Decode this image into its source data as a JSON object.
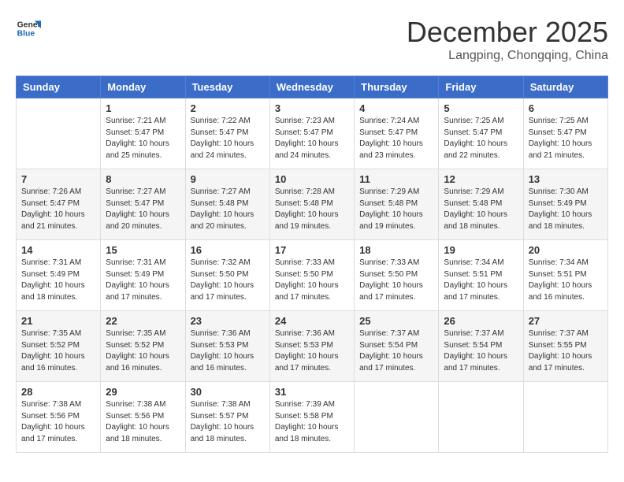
{
  "header": {
    "logo_line1": "General",
    "logo_line2": "Blue",
    "month": "December 2025",
    "location": "Langping, Chongqing, China"
  },
  "days_of_week": [
    "Sunday",
    "Monday",
    "Tuesday",
    "Wednesday",
    "Thursday",
    "Friday",
    "Saturday"
  ],
  "weeks": [
    [
      {
        "day": "",
        "content": ""
      },
      {
        "day": "1",
        "content": "Sunrise: 7:21 AM\nSunset: 5:47 PM\nDaylight: 10 hours\nand 25 minutes."
      },
      {
        "day": "2",
        "content": "Sunrise: 7:22 AM\nSunset: 5:47 PM\nDaylight: 10 hours\nand 24 minutes."
      },
      {
        "day": "3",
        "content": "Sunrise: 7:23 AM\nSunset: 5:47 PM\nDaylight: 10 hours\nand 24 minutes."
      },
      {
        "day": "4",
        "content": "Sunrise: 7:24 AM\nSunset: 5:47 PM\nDaylight: 10 hours\nand 23 minutes."
      },
      {
        "day": "5",
        "content": "Sunrise: 7:25 AM\nSunset: 5:47 PM\nDaylight: 10 hours\nand 22 minutes."
      },
      {
        "day": "6",
        "content": "Sunrise: 7:25 AM\nSunset: 5:47 PM\nDaylight: 10 hours\nand 21 minutes."
      }
    ],
    [
      {
        "day": "7",
        "content": "Sunrise: 7:26 AM\nSunset: 5:47 PM\nDaylight: 10 hours\nand 21 minutes."
      },
      {
        "day": "8",
        "content": "Sunrise: 7:27 AM\nSunset: 5:47 PM\nDaylight: 10 hours\nand 20 minutes."
      },
      {
        "day": "9",
        "content": "Sunrise: 7:27 AM\nSunset: 5:48 PM\nDaylight: 10 hours\nand 20 minutes."
      },
      {
        "day": "10",
        "content": "Sunrise: 7:28 AM\nSunset: 5:48 PM\nDaylight: 10 hours\nand 19 minutes."
      },
      {
        "day": "11",
        "content": "Sunrise: 7:29 AM\nSunset: 5:48 PM\nDaylight: 10 hours\nand 19 minutes."
      },
      {
        "day": "12",
        "content": "Sunrise: 7:29 AM\nSunset: 5:48 PM\nDaylight: 10 hours\nand 18 minutes."
      },
      {
        "day": "13",
        "content": "Sunrise: 7:30 AM\nSunset: 5:49 PM\nDaylight: 10 hours\nand 18 minutes."
      }
    ],
    [
      {
        "day": "14",
        "content": "Sunrise: 7:31 AM\nSunset: 5:49 PM\nDaylight: 10 hours\nand 18 minutes."
      },
      {
        "day": "15",
        "content": "Sunrise: 7:31 AM\nSunset: 5:49 PM\nDaylight: 10 hours\nand 17 minutes."
      },
      {
        "day": "16",
        "content": "Sunrise: 7:32 AM\nSunset: 5:50 PM\nDaylight: 10 hours\nand 17 minutes."
      },
      {
        "day": "17",
        "content": "Sunrise: 7:33 AM\nSunset: 5:50 PM\nDaylight: 10 hours\nand 17 minutes."
      },
      {
        "day": "18",
        "content": "Sunrise: 7:33 AM\nSunset: 5:50 PM\nDaylight: 10 hours\nand 17 minutes."
      },
      {
        "day": "19",
        "content": "Sunrise: 7:34 AM\nSunset: 5:51 PM\nDaylight: 10 hours\nand 17 minutes."
      },
      {
        "day": "20",
        "content": "Sunrise: 7:34 AM\nSunset: 5:51 PM\nDaylight: 10 hours\nand 16 minutes."
      }
    ],
    [
      {
        "day": "21",
        "content": "Sunrise: 7:35 AM\nSunset: 5:52 PM\nDaylight: 10 hours\nand 16 minutes."
      },
      {
        "day": "22",
        "content": "Sunrise: 7:35 AM\nSunset: 5:52 PM\nDaylight: 10 hours\nand 16 minutes."
      },
      {
        "day": "23",
        "content": "Sunrise: 7:36 AM\nSunset: 5:53 PM\nDaylight: 10 hours\nand 16 minutes."
      },
      {
        "day": "24",
        "content": "Sunrise: 7:36 AM\nSunset: 5:53 PM\nDaylight: 10 hours\nand 17 minutes."
      },
      {
        "day": "25",
        "content": "Sunrise: 7:37 AM\nSunset: 5:54 PM\nDaylight: 10 hours\nand 17 minutes."
      },
      {
        "day": "26",
        "content": "Sunrise: 7:37 AM\nSunset: 5:54 PM\nDaylight: 10 hours\nand 17 minutes."
      },
      {
        "day": "27",
        "content": "Sunrise: 7:37 AM\nSunset: 5:55 PM\nDaylight: 10 hours\nand 17 minutes."
      }
    ],
    [
      {
        "day": "28",
        "content": "Sunrise: 7:38 AM\nSunset: 5:56 PM\nDaylight: 10 hours\nand 17 minutes."
      },
      {
        "day": "29",
        "content": "Sunrise: 7:38 AM\nSunset: 5:56 PM\nDaylight: 10 hours\nand 18 minutes."
      },
      {
        "day": "30",
        "content": "Sunrise: 7:38 AM\nSunset: 5:57 PM\nDaylight: 10 hours\nand 18 minutes."
      },
      {
        "day": "31",
        "content": "Sunrise: 7:39 AM\nSunset: 5:58 PM\nDaylight: 10 hours\nand 18 minutes."
      },
      {
        "day": "",
        "content": ""
      },
      {
        "day": "",
        "content": ""
      },
      {
        "day": "",
        "content": ""
      }
    ]
  ]
}
